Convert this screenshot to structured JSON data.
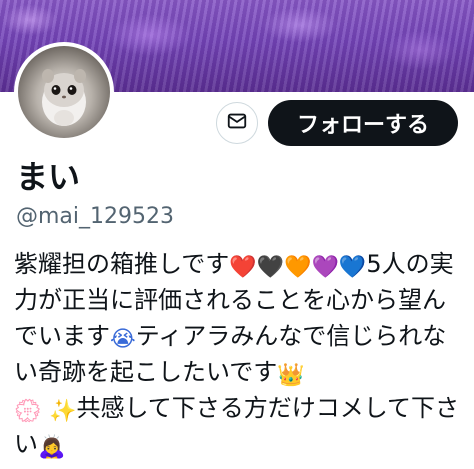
{
  "profile": {
    "name": "まい",
    "handle": "@mai_129523",
    "follow_label": "フォローする",
    "bio_segments": [
      {
        "type": "text",
        "value": "紫耀担の箱推しです"
      },
      {
        "type": "emoji",
        "value": "❤️",
        "color": "#e0142b"
      },
      {
        "type": "emoji",
        "value": "🖤",
        "color": "#111111"
      },
      {
        "type": "emoji",
        "value": "🧡",
        "color": "#f08a12"
      },
      {
        "type": "emoji",
        "value": "💜",
        "color": "#8a2bd6"
      },
      {
        "type": "emoji",
        "value": "💙",
        "color": "#1a3fe0"
      },
      {
        "type": "text",
        "value": "5人の実力が正当に評価されることを心から望んでいます"
      },
      {
        "type": "emoji",
        "value": "😭",
        "color": "#3a6bd8"
      },
      {
        "type": "text",
        "value": "ティアラみんなで信じられない奇跡を起こしたいです"
      },
      {
        "type": "emoji",
        "value": "👑",
        "color": "#f0a81a"
      },
      {
        "type": "text",
        "value": "\n"
      },
      {
        "type": "emoji",
        "value": "💮",
        "color": "#e46cc0"
      },
      {
        "type": "text",
        "value": " "
      },
      {
        "type": "emoji",
        "value": "✨",
        "color": "#c8a0f0"
      },
      {
        "type": "text",
        "value": "共感して下さる方だけコメして下さい"
      },
      {
        "type": "emoji",
        "value": "🙇‍♀️",
        "color": "#d26a2a"
      }
    ]
  },
  "icons": {
    "mail": "envelope-icon",
    "avatar": "avatar-flying-squirrel"
  }
}
